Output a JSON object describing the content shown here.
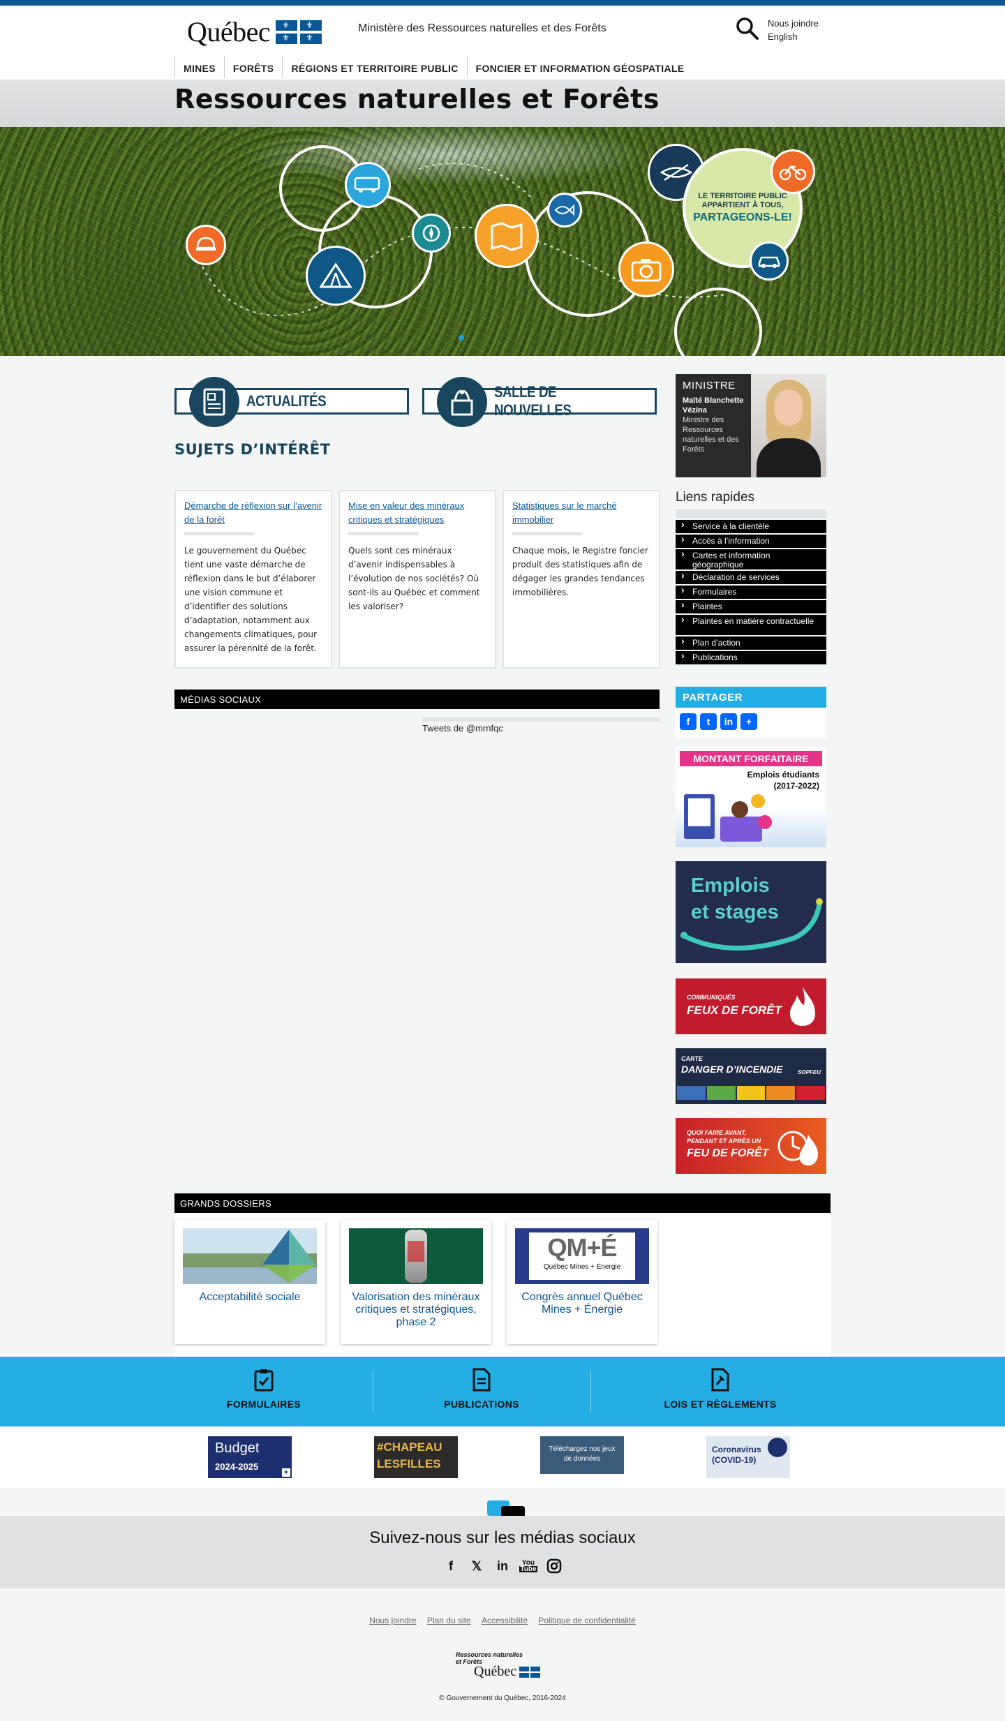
{
  "header": {
    "logo_word": "Québec",
    "ministry_name": "Ministère des Ressources naturelles et des Forêts",
    "contact_link": "Nous joindre",
    "language_link": "English",
    "nav": [
      "MINES",
      "FORÊTS",
      "RÉGIONS ET TERRITOIRE PUBLIC",
      "FONCIER ET INFORMATION GÉOSPATIALE"
    ]
  },
  "page_title": "Ressources naturelles et Forêts",
  "hero": {
    "slogan_line1": "LE TERRITOIRE PUBLIC\nAPPARTIENT À TOUS,",
    "slogan_line2": "PARTAGEONS-LE!"
  },
  "buttons": {
    "news": "ACTUALITÉS",
    "newsroom": "SALLE DE NOUVELLES"
  },
  "topics": {
    "title": "SUJETS D’INTÉRÊT",
    "cards": [
      {
        "title": "Démarche de réflexion sur l’avenir de la forêt",
        "text": "Le gouvernement du Québec tient une vaste démarche de réflexion dans le but d’élaborer une vision commune et d’identifier des solutions d’adaptation, notamment aux changements climatiques, pour assurer la pérennité de la forêt."
      },
      {
        "title": "Mise en valeur des minéraux critiques et stratégiques",
        "text": "Quels sont ces minéraux d’avenir indispensables à l’évolution de nos sociétés? Où sont-ils au Québec et comment les valoriser?"
      },
      {
        "title": "Statistiques sur le marché immobilier",
        "text": "Chaque mois, le Registre foncier produit des statistiques afin de dégager les grandes tendances immobilières."
      }
    ]
  },
  "social_media_section": {
    "title": "MÉDIAS SOCIAUX",
    "tweets_label": "Tweets de @mrnfqc"
  },
  "minister": {
    "heading": "MINISTRE",
    "name": "Maïté Blanchette Vézina",
    "role": "Ministre des Ressources naturelles et des Forêts"
  },
  "quick_links": {
    "title": "Liens rapides",
    "items": [
      "Service à la clientèle",
      "Accès à l’information",
      "Cartes et information géographique",
      "Déclaration de services",
      "Formulaires",
      "Plaintes",
      "Plaintes en matière contractuelle",
      "Plan d’action",
      "Publications"
    ]
  },
  "share": {
    "title": "PARTAGER",
    "icons": [
      "facebook-icon",
      "twitter-icon",
      "linkedin-icon",
      "share-icon"
    ]
  },
  "side_banners": {
    "forfait_title": "MONTANT FORFAITAIRE",
    "forfait_sub1": "Emplois étudiants",
    "forfait_sub2": "(2017-2022)",
    "emplois_line1": "Emplois",
    "emplois_line2": "et stages",
    "feux_small": "COMMUNIQUÉS",
    "feux_big": "FEUX DE FORÊT",
    "danger_small": "CARTE",
    "danger_big": "DANGER D’INCENDIE",
    "danger_brand": "SOPFEU",
    "quoi_small1": "QUOI FAIRE AVANT,",
    "quoi_small2": "PENDANT ET APRÈS UN",
    "quoi_big": "FEU DE FORÊT"
  },
  "dossiers": {
    "title": "GRANDS DOSSIERS",
    "items": [
      {
        "caption": "Acceptabilité sociale"
      },
      {
        "caption": "Valorisation des minéraux critiques et stratégiques, phase 2"
      },
      {
        "caption": "Congrès annuel Québec Mines + Énergie",
        "logo_text": "QM+É",
        "logo_sub": "Québec Mines + Énergie"
      }
    ]
  },
  "blue_band": [
    "FORMULAIRES",
    "PUBLICATIONS",
    "LOIS ET RÈGLEMENTS"
  ],
  "partners": {
    "budget_line1": "Budget",
    "budget_line2": "2024-2025",
    "chapeau_line1": "#CHAPEAU",
    "chapeau_line2": "LESFILLES",
    "donnees": "Téléchargez nos jeux de données",
    "covid_line1": "Coronavirus",
    "covid_line2": "(COVID-19)"
  },
  "follow": {
    "title": "Suivez-nous sur les médias sociaux",
    "icons": [
      "facebook-icon",
      "x-icon",
      "linkedin-icon",
      "youtube-icon",
      "instagram-icon"
    ]
  },
  "footer": {
    "links": [
      "Nous joindre",
      "Plan du site",
      "Accessibilité",
      "Politique de confidentialité"
    ],
    "ministry_line1": "Ressources naturelles",
    "ministry_line2": "et Forêts",
    "logo_word": "Québec",
    "copyright": "© Gouvernement du Québec, 2016-2024"
  },
  "colors": {
    "quebec_blue": "#095797",
    "dark_teal": "#17465e",
    "sky_blue": "#24aee4",
    "black_bar": "#000000"
  }
}
